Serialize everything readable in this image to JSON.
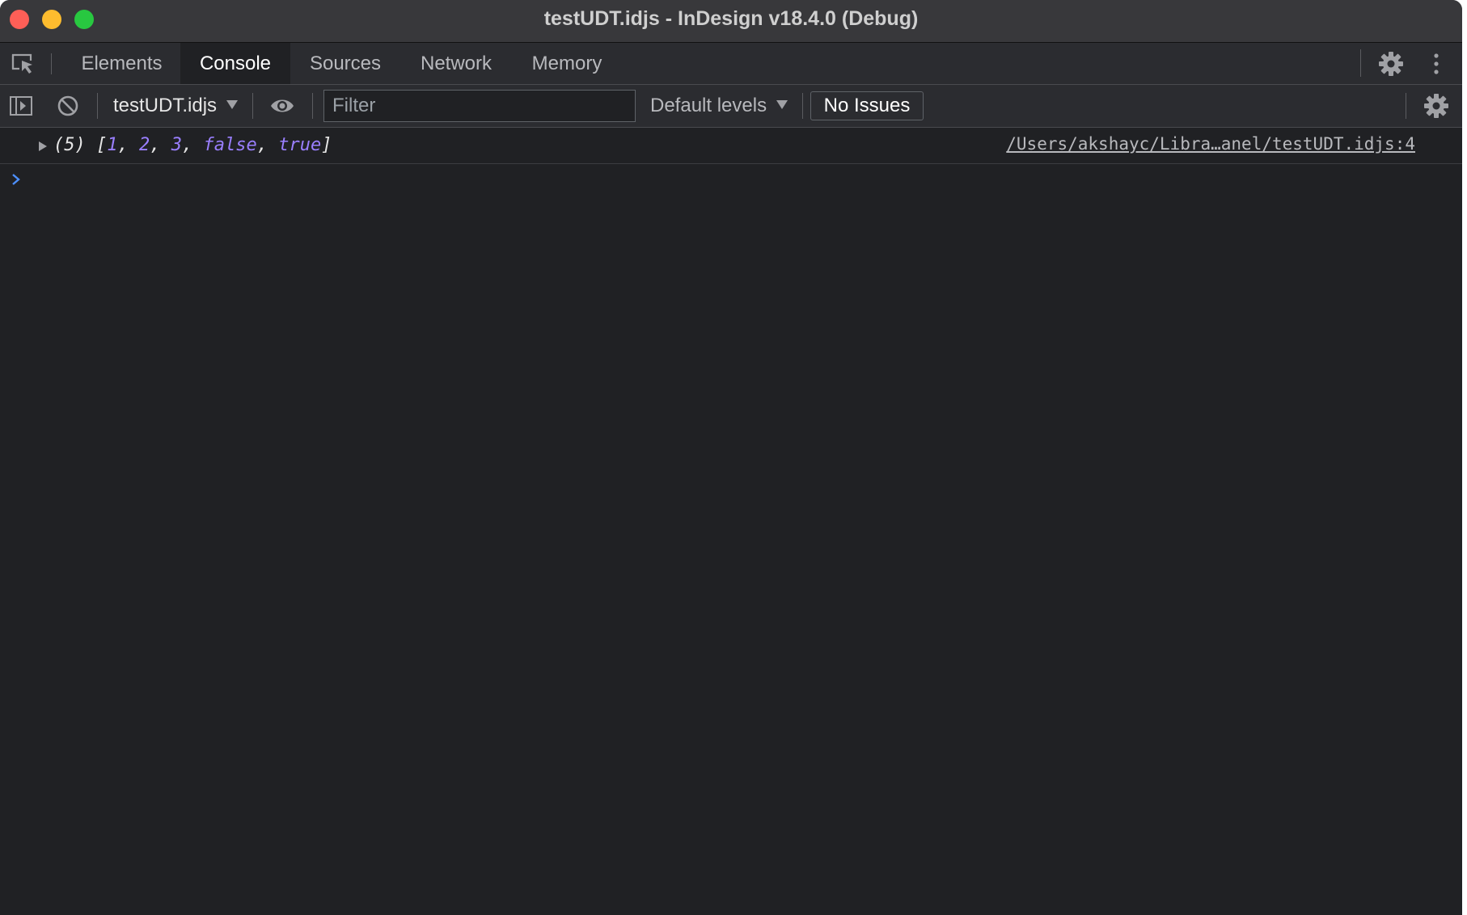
{
  "window": {
    "title": "testUDT.idjs - InDesign v18.4.0 (Debug)"
  },
  "tabs": [
    {
      "label": "Elements",
      "active": false
    },
    {
      "label": "Console",
      "active": true
    },
    {
      "label": "Sources",
      "active": false
    },
    {
      "label": "Network",
      "active": false
    },
    {
      "label": "Memory",
      "active": false
    }
  ],
  "toolbar": {
    "context": "testUDT.idjs",
    "filter_placeholder": "Filter",
    "levels": "Default levels",
    "issues": "No Issues"
  },
  "console": {
    "messages": [
      {
        "length_prefix": "(5) ",
        "open_bracket": "[",
        "values": [
          "1",
          "2",
          "3",
          "false",
          "true"
        ],
        "close_bracket": "]",
        "source": "/Users/akshayc/Libra…anel/testUDT.idjs:4"
      }
    ]
  },
  "icons": {
    "inspect": "inspect-element-icon",
    "settings": "gear-icon",
    "more": "kebab-menu-icon",
    "sidebar": "show-sidebar-icon",
    "clear": "clear-console-icon",
    "live_expression": "eye-icon",
    "prompt": "chevron-right-icon"
  },
  "colors": {
    "background": "#202124",
    "toolbar": "#2b2c30",
    "titlebar": "#38383b",
    "value": "#9a7fff",
    "prompt": "#4d90fe"
  }
}
